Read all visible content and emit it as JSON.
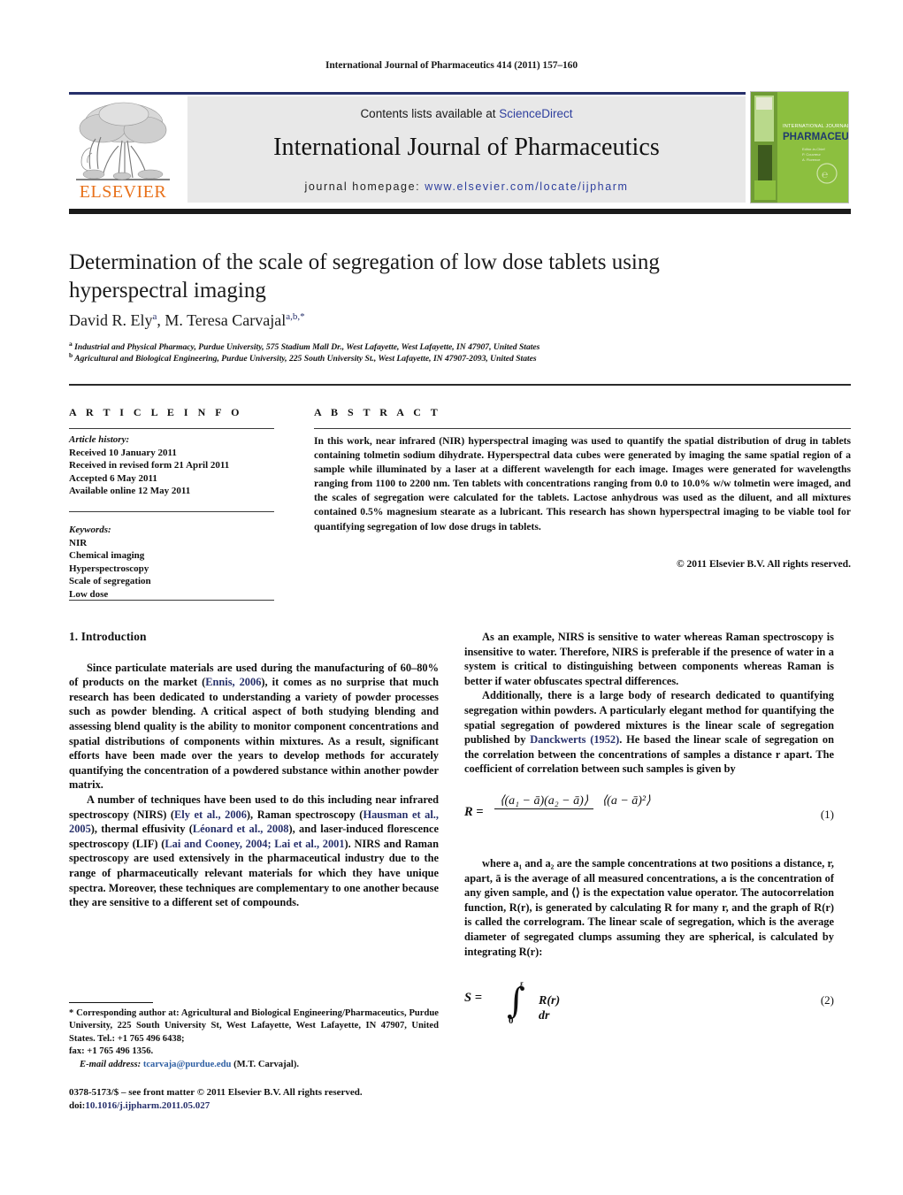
{
  "running_head": "International Journal of Pharmaceutics 414 (2011) 157–160",
  "masthead": {
    "publisher_wordmark": "ELSEVIER",
    "contents_prefix": "Contents lists available at ",
    "contents_link": "ScienceDirect",
    "journal_name": "International Journal of Pharmaceutics",
    "homepage_label": "journal homepage:",
    "homepage_url": "www.elsevier.com/locate/ijpharm",
    "cover_title_small": "INTERNATIONAL JOURNAL OF",
    "cover_title_large": "PHARMACEUTICS",
    "colors": {
      "rule": "#27306b",
      "link": "#2e3f9e",
      "panel": "#e8e8e8",
      "elsevier_orange": "#e8711a",
      "cover_green": "#8cbf3f",
      "dark_bar": "#1b1b1b"
    }
  },
  "article": {
    "title": "Determination of the scale of segregation of low dose tablets using hyperspectral imaging",
    "authors": "David R. Ely",
    "author1_sup": "a",
    "authors2": ", M. Teresa Carvajal",
    "author2_sup": "a,b,*",
    "affiliations": [
      {
        "marker": "a",
        "text": "Industrial and Physical Pharmacy, Purdue University, 575 Stadium Mall Dr., West Lafayette, West Lafayette, IN 47907, United States"
      },
      {
        "marker": "b",
        "text": "Agricultural and Biological Engineering, Purdue University, 225 South University St., West Lafayette, IN 47907-2093, United States"
      }
    ]
  },
  "info": {
    "heading": "A R T I C L E   I N F O",
    "history_label": "Article history:",
    "history": [
      "Received 10 January 2011",
      "Received in revised form 21 April 2011",
      "Accepted 6 May 2011",
      "Available online 12 May 2011"
    ],
    "keywords_label": "Keywords:",
    "keywords": [
      "NIR",
      "Chemical imaging",
      "Hyperspectroscopy",
      "Scale of segregation",
      "Low dose"
    ]
  },
  "abstract": {
    "heading": "A B S T R A C T",
    "text": "In this work, near infrared (NIR) hyperspectral imaging was used to quantify the spatial distribution of drug in tablets containing tolmetin sodium dihydrate. Hyperspectral data cubes were generated by imaging the same spatial region of a sample while illuminated by a laser at a different wavelength for each image. Images were generated for wavelengths ranging from 1100 to 2200 nm. Ten tablets with concentrations ranging from 0.0 to 10.0% w/w tolmetin were imaged, and the scales of segregation were calculated for the tablets. Lactose anhydrous was used as the diluent, and all mixtures contained 0.5% magnesium stearate as a lubricant. This research has shown hyperspectral imaging to be viable tool for quantifying segregation of low dose drugs in tablets.",
    "copyright": "© 2011 Elsevier B.V. All rights reserved."
  },
  "body": {
    "intro_heading": "1. Introduction",
    "left_paragraphs": [
      {
        "segments": [
          {
            "t": "Since particulate materials are used during the manufacturing of 60–80% of products on the market ("
          },
          {
            "t": "Ennis, 2006",
            "ref": true
          },
          {
            "t": "), it comes as no surprise that much research has been dedicated to understanding a variety of powder processes such as powder blending. A critical aspect of both studying blending and assessing blend quality is the ability to monitor component concentrations and spatial distributions of components within mixtures. As a result, significant efforts have been made over the years to develop methods for accurately quantifying the concentration of a powdered substance within another powder matrix."
          }
        ]
      },
      {
        "segments": [
          {
            "t": "A number of techniques have been used to do this including near infrared spectroscopy (NIRS) ("
          },
          {
            "t": "Ely et al., 2006",
            "ref": true
          },
          {
            "t": "), Raman spectroscopy ("
          },
          {
            "t": "Hausman et al., 2005",
            "ref": true
          },
          {
            "t": "), thermal effusivity ("
          },
          {
            "t": "Léonard et al., 2008",
            "ref": true
          },
          {
            "t": "), and laser-induced florescence spectroscopy (LIF) ("
          },
          {
            "t": "Lai and Cooney, 2004; Lai et al., 2001",
            "ref": true
          },
          {
            "t": "). NIRS and Raman spectroscopy are used extensively in the pharmaceutical industry due to the range of pharmaceutically relevant materials for which they have unique spectra. Moreover, these techniques are complementary to one another because they are sensitive to a different set of compounds."
          }
        ]
      }
    ],
    "right_paragraphs_top": [
      {
        "segments": [
          {
            "t": "As an example, NIRS is sensitive to water whereas Raman spectroscopy is insensitive to water. Therefore, NIRS is preferable if the presence of water in a system is critical to distinguishing between components whereas Raman is better if water obfuscates spectral differences."
          }
        ]
      },
      {
        "segments": [
          {
            "t": "Additionally, there is a large body of research dedicated to quantifying segregation within powders. A particularly elegant method for quantifying the spatial segregation of powdered mixtures is the linear scale of segregation published by "
          },
          {
            "t": "Danckwerts (1952)",
            "ref": true
          },
          {
            "t": ". He based the linear scale of segregation on the correlation between the concentrations of samples a distance r apart. The coefficient of correlation between such samples is given by"
          }
        ]
      }
    ],
    "equation1": {
      "lhs": "R =",
      "numerator": "⟨(a₁ − ā)(a₂ − ā)⟩",
      "denominator": "⟨(a − ā)²⟩",
      "number": "(1)"
    },
    "right_paragraph_mid": {
      "segments": [
        {
          "t": "where a₁ and a₂ are the sample concentrations at two positions a distance, r, apart, ā is the average of all measured concentrations, a is the concentration of any given sample, and ⟨⟩ is the expectation value operator. The autocorrelation function, R(r), is generated by calculating R for many r, and the graph of R(r) is called the correlogram. The linear scale of segregation, which is the average diameter of segregated clumps assuming they are spherical, is calculated by integrating R(r):"
        }
      ]
    },
    "equation2": {
      "lhs": "S =",
      "upper_limit": "ξ",
      "lower_limit": "0",
      "integrand": "R(r) dr",
      "number": "(2)"
    }
  },
  "footer": {
    "corresponding": "* Corresponding author at: Agricultural and Biological Engineering/Pharmaceutics, Purdue University, 225 South University St, West Lafayette, West Lafayette, IN 47907, United States. Tel.: +1 765 496 6438;",
    "fax": "fax: +1 765 496 1356.",
    "email_label": "E-mail address:",
    "email": "tcarvaja@purdue.edu",
    "email_suffix": "(M.T. Carvajal).",
    "issn_line": "0378-5173/$ – see front matter © 2011 Elsevier B.V. All rights reserved.",
    "doi_label": "doi:",
    "doi": "10.1016/j.ijpharm.2011.05.027"
  }
}
